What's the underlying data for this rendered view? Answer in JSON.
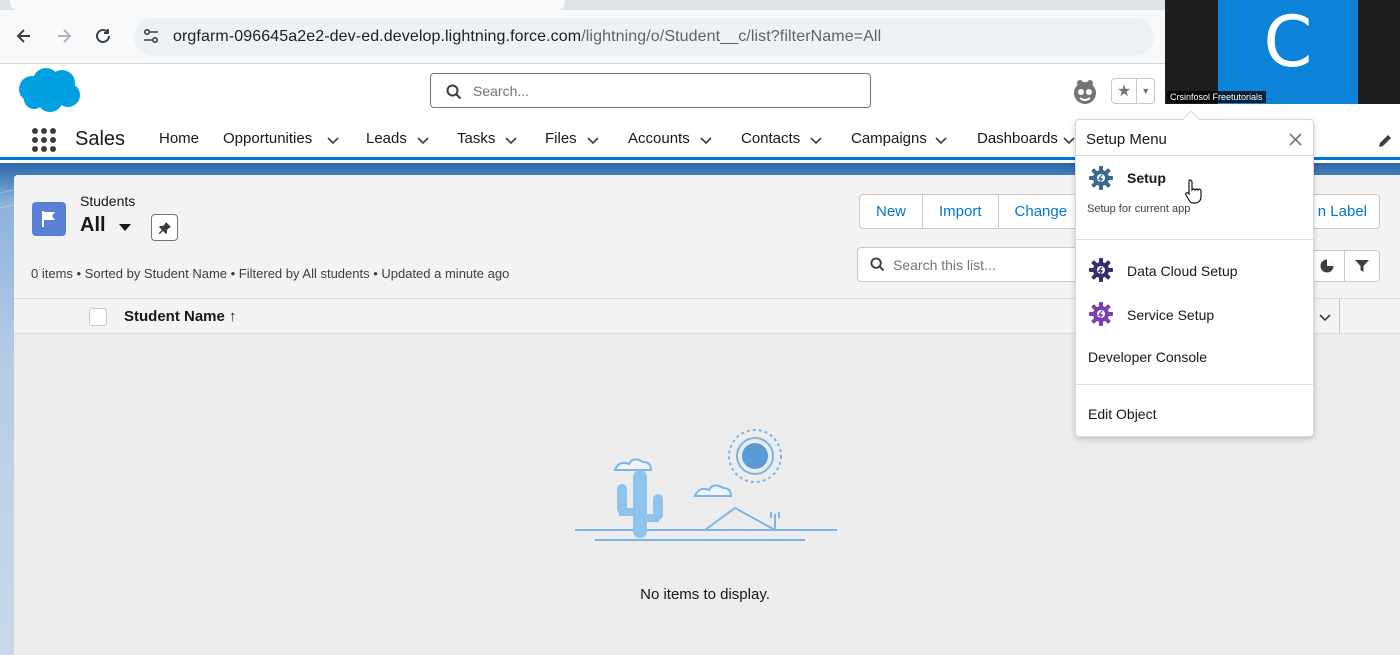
{
  "browser": {
    "url_host": "orgfarm-096645a2e2-dev-ed.develop.lightning.force.com",
    "url_path": "/lightning/o/Student__c/list?filterName=All",
    "icons": [
      "back-arrow-icon",
      "forward-arrow-icon",
      "reload-icon",
      "site-info-icon"
    ]
  },
  "video": {
    "letter": "C",
    "label": "Crsinfosol Freetutorials"
  },
  "header": {
    "search_placeholder": "Search..."
  },
  "app": {
    "name": "Sales",
    "nav": [
      "Home",
      "Opportunities",
      "Leads",
      "Tasks",
      "Files",
      "Accounts",
      "Contacts",
      "Campaigns",
      "Dashboards"
    ]
  },
  "list": {
    "object_label": "Students",
    "view_name": "All",
    "meta": "0 items • Sorted by Student Name • Filtered by All students • Updated a minute ago",
    "buttons": [
      "New",
      "Import",
      "Change"
    ],
    "right_button": "n Label",
    "search_placeholder": "Search this list...",
    "column_header": "Student Name",
    "sort_arrow": "↑",
    "empty_text": "No items to display."
  },
  "setup_menu": {
    "title": "Setup Menu",
    "items": [
      {
        "label": "Setup",
        "sub": "Setup for current app"
      },
      {
        "label": "Data Cloud Setup"
      },
      {
        "label": "Service Setup"
      },
      {
        "label": "Developer Console"
      },
      {
        "label": "Edit Object"
      }
    ]
  },
  "colors": {
    "brand_blue": "#0176d3",
    "salesforce_cloud": "#00a1e0",
    "setup_gear": "#3a6a8c",
    "data_cloud_gear": "#3b2c6b",
    "service_gear": "#7a3fb0"
  }
}
